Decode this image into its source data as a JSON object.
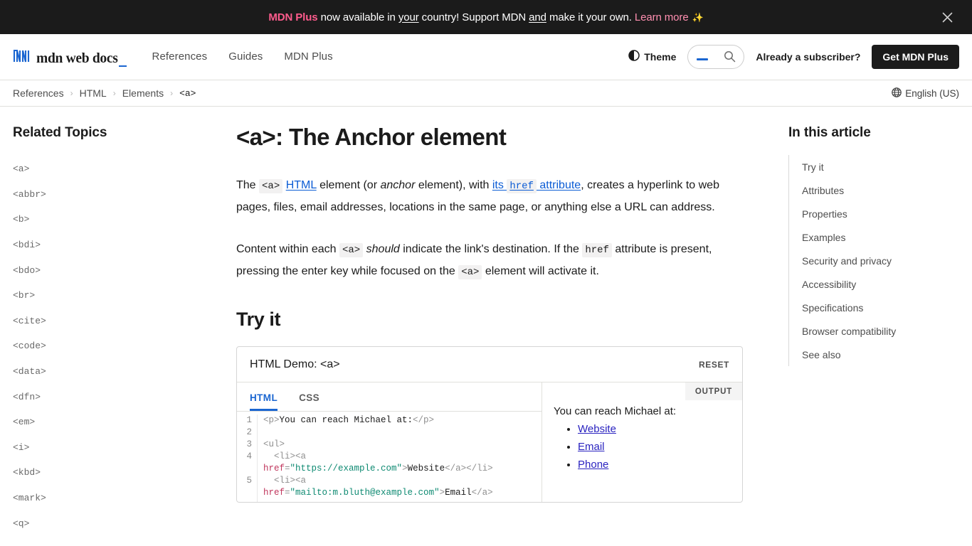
{
  "banner": {
    "brand": "MDN Plus",
    "text_before": " now available in ",
    "underline_1": "your",
    "text_mid": " country! Support MDN ",
    "underline_2": "and",
    "text_after": " make it your own. ",
    "learn_more": "Learn more",
    "sparkle": "✨",
    "close_icon": "close-icon"
  },
  "header": {
    "logo_text": "mdn web docs",
    "nav": [
      {
        "label": "References"
      },
      {
        "label": "Guides"
      },
      {
        "label": "MDN Plus"
      }
    ],
    "theme_label": "Theme",
    "theme_icon": "contrast-icon",
    "search_icon": "search-icon",
    "search_placeholder": "",
    "search_value": "",
    "subscriber_label": "Already a subscriber?",
    "cta_label": "Get MDN Plus"
  },
  "breadcrumb": {
    "items": [
      "References",
      "HTML",
      "Elements",
      "<a>"
    ],
    "separator": "›",
    "language_label": "English (US)",
    "globe_icon": "globe-icon"
  },
  "sidebar": {
    "title": "Related Topics",
    "items": [
      {
        "label": "<a>"
      },
      {
        "label": "<abbr>"
      },
      {
        "label": "<b>"
      },
      {
        "label": "<bdi>"
      },
      {
        "label": "<bdo>"
      },
      {
        "label": "<br>"
      },
      {
        "label": "<cite>"
      },
      {
        "label": "<code>"
      },
      {
        "label": "<data>"
      },
      {
        "label": "<dfn>"
      },
      {
        "label": "<em>"
      },
      {
        "label": "<i>"
      },
      {
        "label": "<kbd>"
      },
      {
        "label": "<mark>"
      },
      {
        "label": "<q>"
      }
    ]
  },
  "article": {
    "title": "<a>: The Anchor element",
    "p1": {
      "t1": "The ",
      "code1": "<a>",
      "link1": "HTML",
      "t2": " element (or ",
      "em1": "anchor",
      "t3": " element), with ",
      "link2_a": "its ",
      "link2_code": "href",
      "link2_b": " attribute",
      "t4": ", creates a hyperlink to web pages, files, email addresses, locations in the same page, or anything else a URL can address."
    },
    "p2": {
      "t1": "Content within each ",
      "code1": "<a>",
      "em1": " should",
      "t2": " indicate the link's destination. If the ",
      "code2": "href",
      "t3": " attribute is present, pressing the enter key while focused on the ",
      "code3": "<a>",
      "t4": " element will activate it."
    },
    "section_try_it": "Try it"
  },
  "demo": {
    "title": "HTML Demo: <a>",
    "reset_label": "RESET",
    "tabs": [
      {
        "label": "HTML",
        "active": true
      },
      {
        "label": "CSS",
        "active": false
      }
    ],
    "line_numbers": [
      "1",
      "2",
      "3",
      "4",
      "",
      "5",
      ""
    ],
    "code": {
      "l1_open": "<p>",
      "l1_text": "You can reach Michael at:",
      "l1_close": "</p>",
      "l3": "<ul>",
      "l4_li": "  <li><a",
      "l4_attr": "href",
      "l4_eq": "=",
      "l4_val": "\"https://example.com\"",
      "l4_gt": ">",
      "l4_text": "Website",
      "l4_close": "</a></li>",
      "l5_li": "  <li><a",
      "l5_attr": "href",
      "l5_eq": "=",
      "l5_val": "\"mailto:m.bluth@example.com\"",
      "l5_gt": ">",
      "l5_text": "Email",
      "l5_close": "</a>"
    },
    "output": {
      "label": "OUTPUT",
      "paragraph": "You can reach Michael at:",
      "links": [
        {
          "label": "Website"
        },
        {
          "label": "Email"
        },
        {
          "label": "Phone"
        }
      ]
    }
  },
  "toc": {
    "title": "In this article",
    "items": [
      {
        "label": "Try it"
      },
      {
        "label": "Attributes"
      },
      {
        "label": "Properties"
      },
      {
        "label": "Examples"
      },
      {
        "label": "Security and privacy"
      },
      {
        "label": "Accessibility"
      },
      {
        "label": "Specifications"
      },
      {
        "label": "Browser compatibility"
      },
      {
        "label": "See also"
      }
    ]
  },
  "colors": {
    "accent_blue": "#1b66d1",
    "link_blue": "#0b5cd5",
    "pink": "#ff5c8d",
    "dark": "#1b1b1b"
  }
}
